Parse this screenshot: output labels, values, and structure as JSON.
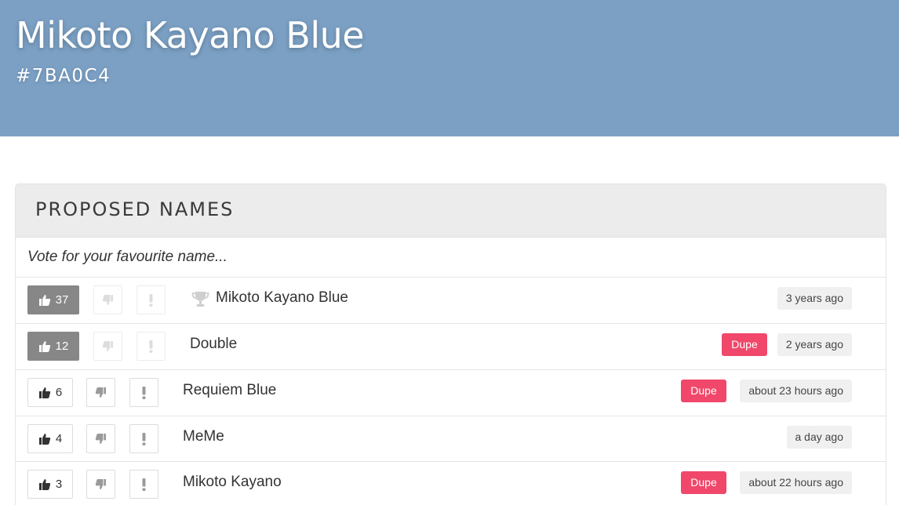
{
  "header": {
    "title": "Mikoto Kayano Blue",
    "hex": "#7BA0C4",
    "background": "#7BA0C4"
  },
  "panel": {
    "title": "PROPOSED NAMES",
    "subtitle": "Vote for your favourite name..."
  },
  "badge_color": "#f0476a",
  "proposals": [
    {
      "votes": "37",
      "name": "Mikoto Kayano Blue",
      "time": "3 years ago",
      "dupe": "",
      "winner": true
    },
    {
      "votes": "12",
      "name": "Double",
      "time": "2 years ago",
      "dupe": "Dupe"
    },
    {
      "votes": "6",
      "name": "Requiem Blue",
      "time": "about 23 hours ago",
      "dupe": "Dupe"
    },
    {
      "votes": "4",
      "name": "MeMe",
      "time": "a day ago",
      "dupe": ""
    },
    {
      "votes": "3",
      "name": "Mikoto Kayano",
      "time": "about 22 hours ago",
      "dupe": "Dupe"
    }
  ]
}
